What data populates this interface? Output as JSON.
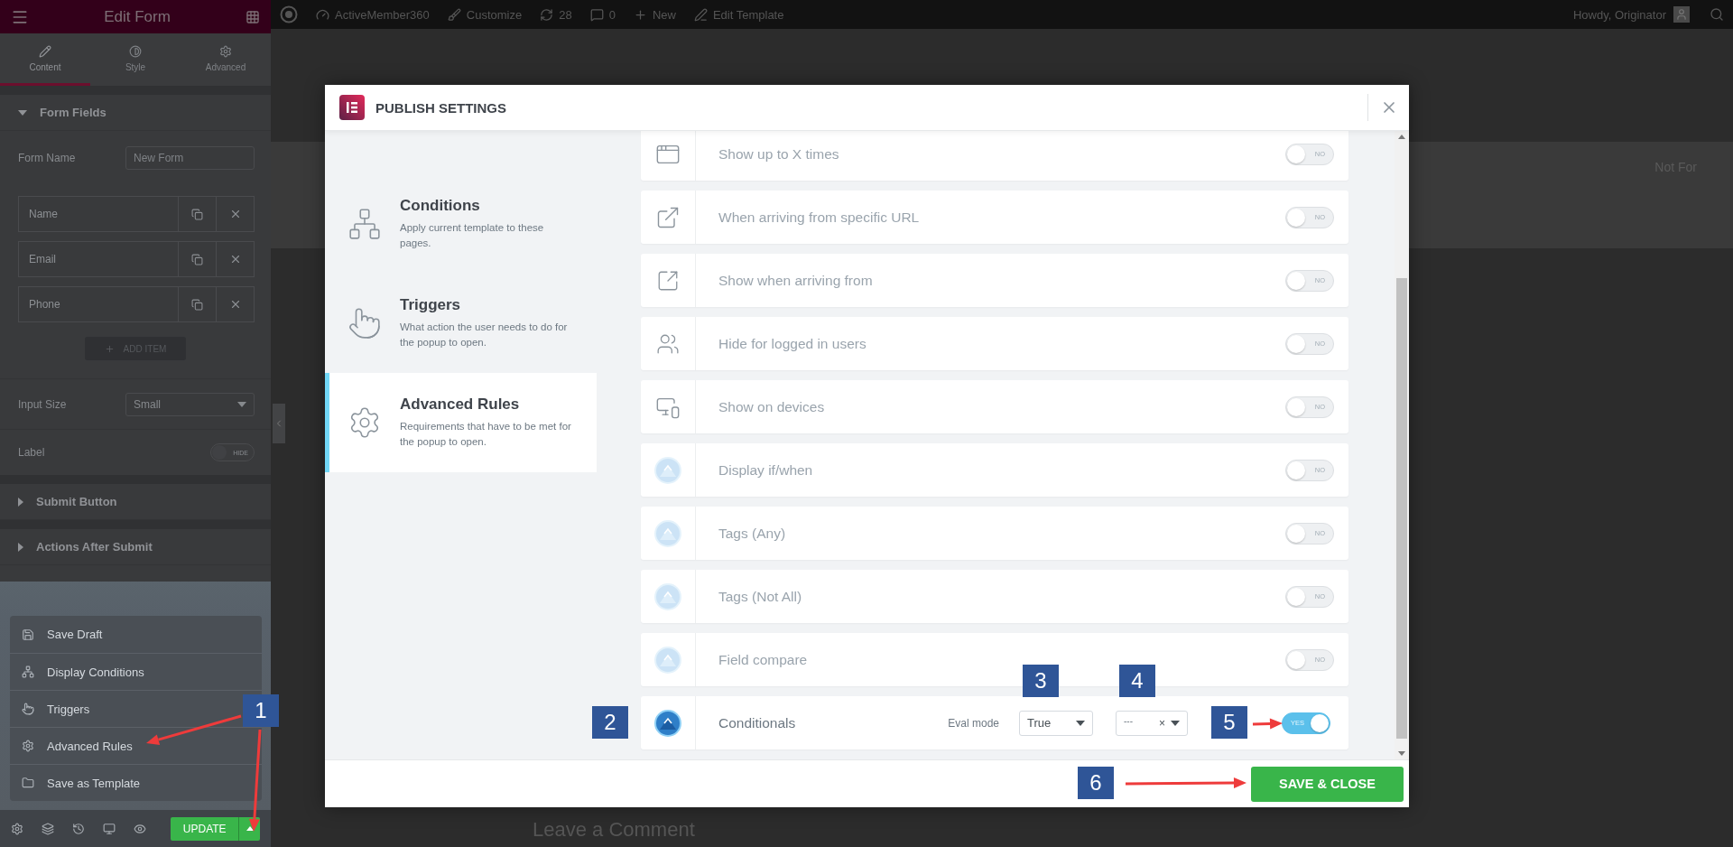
{
  "editor_panel": {
    "title": "Edit Form",
    "tabs": [
      {
        "label": "Content",
        "selected": true
      },
      {
        "label": "Style",
        "selected": false
      },
      {
        "label": "Advanced",
        "selected": false
      }
    ],
    "form_fields": {
      "title": "Form Fields",
      "expanded": true,
      "form_name": {
        "label": "Form Name",
        "placeholder": "New Form"
      },
      "items": [
        "Name",
        "Email",
        "Phone"
      ],
      "add_item": "ADD ITEM",
      "input_size": {
        "label": "Input Size",
        "value": "Small"
      },
      "label_toggle": {
        "label": "Label",
        "on": false,
        "text": "HIDE"
      }
    },
    "sections": [
      {
        "title": "Submit Button",
        "expanded": false
      },
      {
        "title": "Actions After Submit",
        "expanded": false
      }
    ],
    "publish_menu": [
      "Save Draft",
      "Display Conditions",
      "Triggers",
      "Advanced Rules",
      "Save as Template"
    ],
    "update_button": "UPDATE"
  },
  "admin_bar": {
    "items": [
      "ActiveMember360",
      "Customize",
      "28",
      "0",
      "New",
      "Edit Template"
    ],
    "greeting": "Howdy, Originator"
  },
  "page_texts": [
    "Not For",
    "Leave a Comment"
  ],
  "modal": {
    "title": "PUBLISH SETTINGS",
    "tabs": [
      {
        "title": "Conditions",
        "description": "Apply current template to these pages.",
        "selected": false
      },
      {
        "title": "Triggers",
        "description": "What action the user needs to do for the popup to open.",
        "selected": false
      },
      {
        "title": "Advanced Rules",
        "description": "Requirements that have to be met for the popup to open.",
        "selected": true
      }
    ],
    "rules": [
      {
        "kind": "builtin",
        "label": "Show up to X times",
        "on": false,
        "toggle_text": "NO"
      },
      {
        "kind": "builtin",
        "label": "When arriving from specific URL",
        "on": false,
        "toggle_text": "NO"
      },
      {
        "kind": "builtin",
        "label": "Show when arriving from",
        "on": false,
        "toggle_text": "NO"
      },
      {
        "kind": "builtin",
        "label": "Hide for logged in users",
        "on": false,
        "toggle_text": "NO"
      },
      {
        "kind": "builtin",
        "label": "Show on devices",
        "on": false,
        "toggle_text": "NO"
      },
      {
        "kind": "addon",
        "label": "Display if/when",
        "on": false,
        "toggle_text": "NO"
      },
      {
        "kind": "addon",
        "label": "Tags (Any)",
        "on": false,
        "toggle_text": "NO"
      },
      {
        "kind": "addon",
        "label": "Tags (Not All)",
        "on": false,
        "toggle_text": "NO"
      },
      {
        "kind": "addon",
        "label": "Field compare",
        "on": false,
        "toggle_text": "NO"
      },
      {
        "kind": "conditional",
        "label": "Conditionals",
        "on": true,
        "toggle_text": "YES",
        "eval_label": "Eval mode",
        "eval_value": "True",
        "multi_value": "---",
        "clear": "×"
      }
    ],
    "save_button": "SAVE & CLOSE"
  },
  "annotations": [
    {
      "label": "1"
    },
    {
      "label": "2"
    },
    {
      "label": "3"
    },
    {
      "label": "4"
    },
    {
      "label": "5"
    },
    {
      "label": "6"
    }
  ]
}
